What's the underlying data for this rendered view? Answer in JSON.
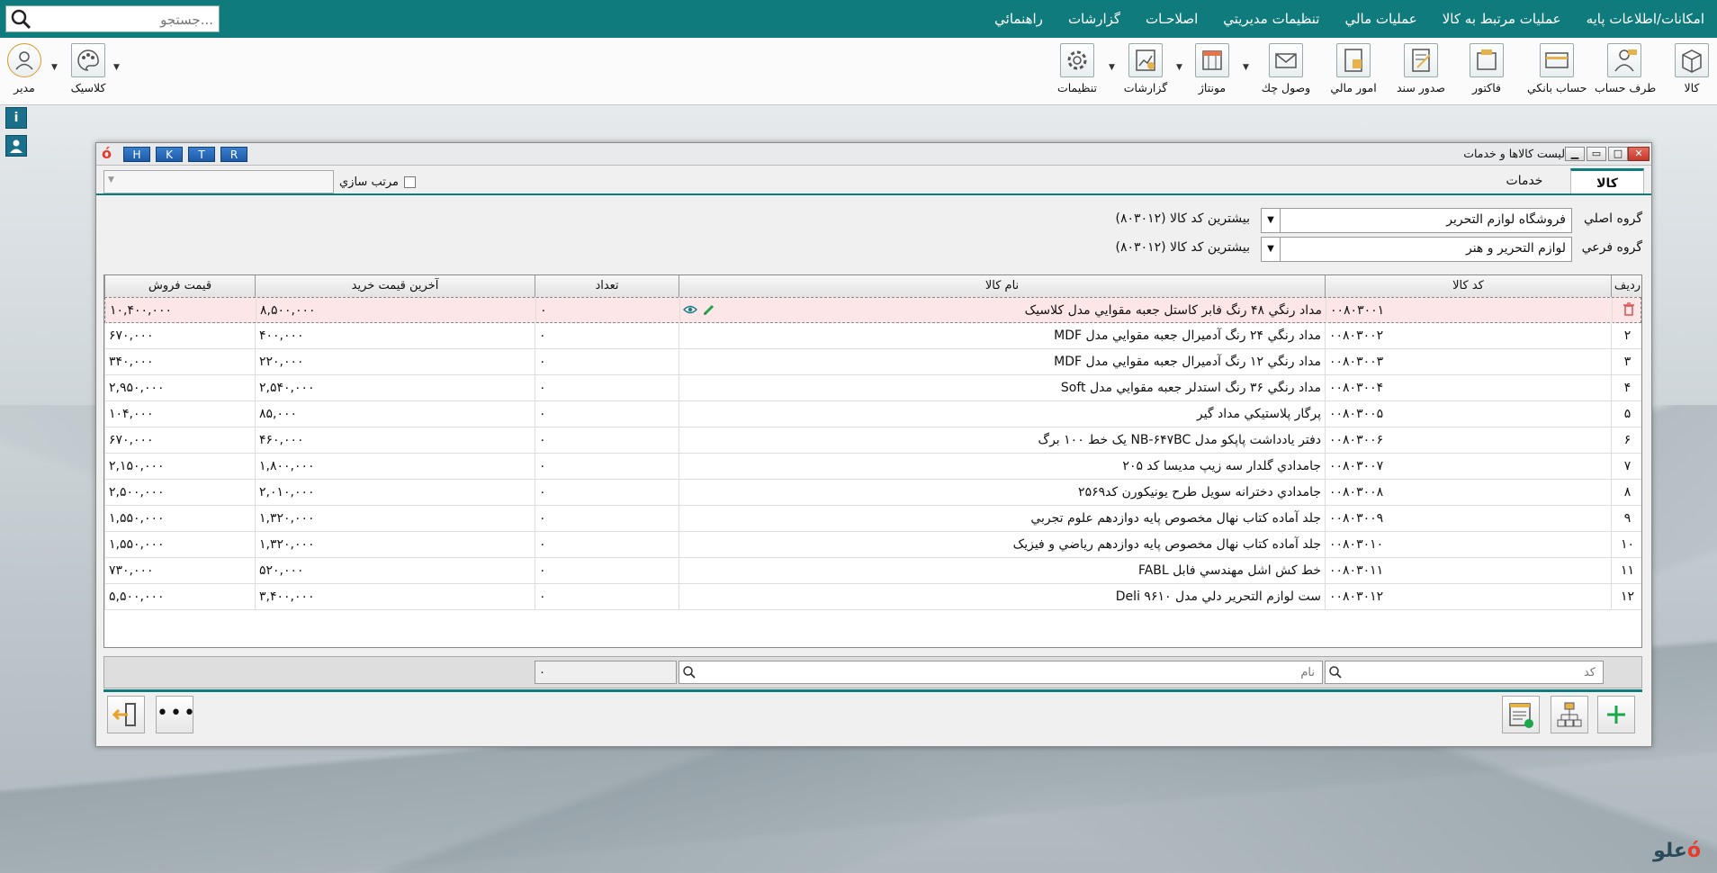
{
  "menu": {
    "items": [
      "امکانات/اطلاعات پايه",
      "عمليات مرتبط به کالا",
      "عمليات مالي",
      "تنظيمات مديريتي",
      "اصلاحـات",
      "گزارشات",
      "راهنمائي"
    ],
    "search_placeholder": "جستجو..."
  },
  "toolbar": {
    "items": [
      "کالا",
      "طرف حساب",
      "حساب بانکي",
      "فاکتور",
      "صدور سند",
      "امور مالي",
      "وصول چك",
      "مونتاژ",
      "گزارشات",
      "تنظيمات"
    ],
    "theme_label": "کلاسيک",
    "user_label": "مدير"
  },
  "window": {
    "title": "ليست کالاها و خدمات",
    "hotkeys": [
      "H",
      "K",
      "T",
      "R"
    ],
    "tabs": [
      "کالا",
      "خدمات"
    ],
    "sort_label": "مرتب سازي"
  },
  "groups": {
    "main_label": "گروه اصلي",
    "main_value": "فروشگاه لوازم التحرير",
    "sub_label": "گروه فرعي",
    "sub_value": "لوازم التحرير و هنر",
    "max_code_1": "بيشترين کد کالا (۸۰۳۰۱۲)",
    "max_code_2": "بيشترين کد کالا (۸۰۳۰۱۲)"
  },
  "table": {
    "headers": {
      "row": "رديف",
      "code": "کد کالا",
      "name": "نام کالا",
      "qty": "تعداد",
      "last_buy": "آخرين قيمت خريد",
      "sell": "قيمت فروش"
    },
    "rows": [
      {
        "row": "",
        "code": "۰۰۸۰۳۰۰۱",
        "name": "مداد رنگي ۴۸ رنگ فابر کاستل جعبه مقوايي مدل کلاسيک",
        "qty": "۰",
        "last_buy": "۸,۵۰۰,۰۰۰",
        "sell": "۱۰,۴۰۰,۰۰۰"
      },
      {
        "row": "۲",
        "code": "۰۰۸۰۳۰۰۲",
        "name": "مداد رنگي ۲۴ رنگ آدميرال جعبه مقوايي مدل MDF",
        "qty": "۰",
        "last_buy": "۴۰۰,۰۰۰",
        "sell": "۶۷۰,۰۰۰"
      },
      {
        "row": "۳",
        "code": "۰۰۸۰۳۰۰۳",
        "name": "مداد رنگي ۱۲ رنگ آدميرال جعبه مقوايي مدل MDF",
        "qty": "۰",
        "last_buy": "۲۲۰,۰۰۰",
        "sell": "۳۴۰,۰۰۰"
      },
      {
        "row": "۴",
        "code": "۰۰۸۰۳۰۰۴",
        "name": "مداد رنگي ۳۶ رنگ استدلر جعبه مقوايي مدل Soft",
        "qty": "۰",
        "last_buy": "۲,۵۴۰,۰۰۰",
        "sell": "۲,۹۵۰,۰۰۰"
      },
      {
        "row": "۵",
        "code": "۰۰۸۰۳۰۰۵",
        "name": "پرگار پلاستيکي مداد گير",
        "qty": "۰",
        "last_buy": "۸۵,۰۰۰",
        "sell": "۱۰۴,۰۰۰"
      },
      {
        "row": "۶",
        "code": "۰۰۸۰۳۰۰۶",
        "name": "دفتر يادداشت پاپکو مدل NB-۶۴۷BC يک خط ۱۰۰ برگ",
        "qty": "۰",
        "last_buy": "۴۶۰,۰۰۰",
        "sell": "۶۷۰,۰۰۰"
      },
      {
        "row": "۷",
        "code": "۰۰۸۰۳۰۰۷",
        "name": "جامدادي گلدار سه زيپ مديسا کد ۲۰۵",
        "qty": "۰",
        "last_buy": "۱,۸۰۰,۰۰۰",
        "sell": "۲,۱۵۰,۰۰۰"
      },
      {
        "row": "۸",
        "code": "۰۰۸۰۳۰۰۸",
        "name": "جامدادي دخترانه سويل طرح يونيکورن کد۲۵۶۹",
        "qty": "۰",
        "last_buy": "۲,۰۱۰,۰۰۰",
        "sell": "۲,۵۰۰,۰۰۰"
      },
      {
        "row": "۹",
        "code": "۰۰۸۰۳۰۰۹",
        "name": "جلد آماده کتاب نهال مخصوص پايه دوازدهم علوم تجربي",
        "qty": "۰",
        "last_buy": "۱,۳۲۰,۰۰۰",
        "sell": "۱,۵۵۰,۰۰۰"
      },
      {
        "row": "۱۰",
        "code": "۰۰۸۰۳۰۱۰",
        "name": "جلد آماده کتاب نهال مخصوص پايه دوازدهم رياضي و فيزيک",
        "qty": "۰",
        "last_buy": "۱,۳۲۰,۰۰۰",
        "sell": "۱,۵۵۰,۰۰۰"
      },
      {
        "row": "۱۱",
        "code": "۰۰۸۰۳۰۱۱",
        "name": "خط کش اشل مهندسي فابل FABL",
        "qty": "۰",
        "last_buy": "۵۲۰,۰۰۰",
        "sell": "۷۳۰,۰۰۰"
      },
      {
        "row": "۱۲",
        "code": "۰۰۸۰۳۰۱۲",
        "name": "ست لوازم التحرير دلي مدل ۹۶۱۰ Deli",
        "qty": "۰",
        "last_buy": "۳,۴۰۰,۰۰۰",
        "sell": "۵,۵۰۰,۰۰۰"
      }
    ]
  },
  "filters": {
    "code_placeholder": "کد",
    "name_placeholder": "نام",
    "qty_total": "۰"
  },
  "brand": {
    "text": "علو"
  },
  "colors": {
    "accent": "#0f7b7c",
    "selected_row": "#fde6e8",
    "close": "#c4382a"
  }
}
